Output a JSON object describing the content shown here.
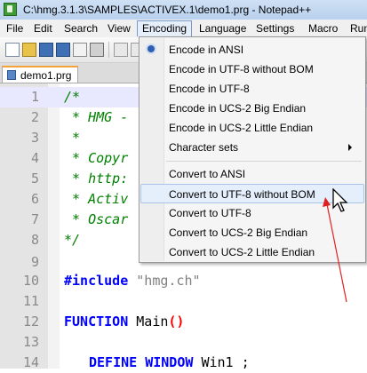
{
  "window": {
    "title": "C:\\hmg.3.1.3\\SAMPLES\\ACTIVEX.1\\demo1.prg - Notepad++"
  },
  "menubar": {
    "items": [
      "File",
      "Edit",
      "Search",
      "View",
      "Encoding",
      "Language",
      "Settings",
      "Macro",
      "Run"
    ]
  },
  "toolbar": {
    "icons": [
      "new-file-icon",
      "open-folder-icon",
      "save-icon",
      "save-all-icon",
      "close-icon",
      "print-icon",
      "cut-icon",
      "copy-icon"
    ]
  },
  "tabs": [
    {
      "label": "demo1.prg"
    }
  ],
  "editor": {
    "lines": [
      {
        "num": "1",
        "text": "/*"
      },
      {
        "num": "2",
        "text": " * HMG -"
      },
      {
        "num": "3",
        "text": " *"
      },
      {
        "num": "4",
        "text": " * Copyr"
      },
      {
        "num": "5",
        "text": " * http:"
      },
      {
        "num": "6",
        "text": " * Activ"
      },
      {
        "num": "7",
        "text": " * Oscar"
      },
      {
        "num": "8",
        "text": "*/"
      },
      {
        "num": "9",
        "text": ""
      },
      {
        "num": "10",
        "keyword": "#include",
        "string": "\"hmg.ch\""
      },
      {
        "num": "11",
        "text": ""
      },
      {
        "num": "12",
        "keyword": "FUNCTION",
        "ident": "Main",
        "paren": "()"
      },
      {
        "num": "13",
        "text": ""
      },
      {
        "num": "14",
        "keyword": "DEFINE WINDOW",
        "ident": "Win1 ;"
      }
    ]
  },
  "encoding_menu": {
    "items": [
      {
        "label": "Encode in ANSI",
        "selected": true
      },
      {
        "label": "Encode in UTF-8 without BOM"
      },
      {
        "label": "Encode in UTF-8"
      },
      {
        "label": "Encode in UCS-2 Big Endian"
      },
      {
        "label": "Encode in UCS-2 Little Endian"
      },
      {
        "label": "Character sets",
        "submenu": true
      }
    ],
    "convert_items": [
      {
        "label": "Convert to ANSI"
      },
      {
        "label": "Convert to UTF-8 without BOM",
        "highlighted": true
      },
      {
        "label": "Convert to UTF-8"
      },
      {
        "label": "Convert to UCS-2 Big Endian"
      },
      {
        "label": "Convert to UCS-2 Little Endian"
      }
    ]
  },
  "colors": {
    "comment": "#008000",
    "keyword": "#0000ff",
    "string": "#808080",
    "annotation_arrow": "#e02020",
    "tab_accent": "#f3a33a"
  }
}
